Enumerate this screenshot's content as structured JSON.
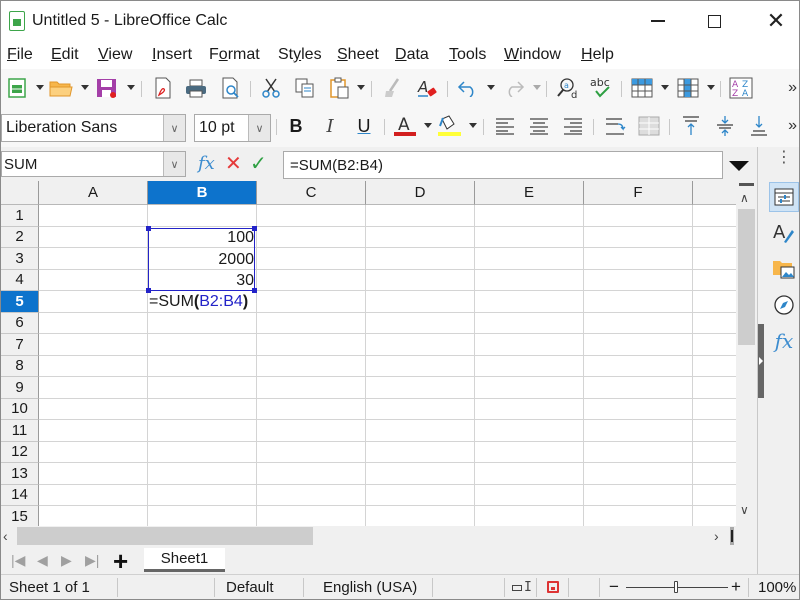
{
  "window": {
    "title": "Untitled 5 - LibreOffice Calc",
    "controls": {
      "minimize": "minimize",
      "maximize": "maximize",
      "close": "close"
    }
  },
  "menubar": {
    "items": [
      {
        "label": "File",
        "mnemonic": "F",
        "rest": "ile"
      },
      {
        "label": "Edit",
        "mnemonic": "E",
        "rest": "dit"
      },
      {
        "label": "View",
        "mnemonic": "V",
        "rest": "iew"
      },
      {
        "label": "Insert",
        "mnemonic": "I",
        "rest": "nsert"
      },
      {
        "label": "Format",
        "pre": "F",
        "mnemonic": "o",
        "rest": "rmat"
      },
      {
        "label": "Styles",
        "pre": "St",
        "mnemonic": "y",
        "rest": "les"
      },
      {
        "label": "Sheet",
        "mnemonic": "S",
        "rest": "heet"
      },
      {
        "label": "Data",
        "mnemonic": "D",
        "rest": "ata"
      },
      {
        "label": "Tools",
        "mnemonic": "T",
        "rest": "ools"
      },
      {
        "label": "Window",
        "mnemonic": "W",
        "rest": "indow"
      },
      {
        "label": "Help",
        "mnemonic": "H",
        "rest": "elp"
      }
    ]
  },
  "standard_toolbar": {
    "icons": [
      "new-spreadsheet-icon",
      "open-icon",
      "save-icon",
      "export-pdf-icon",
      "print-icon",
      "print-preview-icon",
      "cut-icon",
      "copy-icon",
      "paste-icon",
      "clone-formatting-icon",
      "clear-formatting-icon",
      "undo-icon",
      "redo-icon",
      "find-replace-icon",
      "spelling-icon",
      "row-icon",
      "column-icon",
      "sort-icon"
    ]
  },
  "formatting_toolbar": {
    "font_name": "Liberation Sans",
    "font_size": "10 pt",
    "bold": "B",
    "italic": "I",
    "underline": "U",
    "font_color_glyph": "A",
    "font_color": "#d21f1f",
    "highlight_color": "#ffff38"
  },
  "formula_bar": {
    "name_box": "SUM",
    "function_wizard": "fx",
    "cancel": "✕",
    "accept": "✓",
    "formula": "=SUM(B2:B4)"
  },
  "sheet": {
    "columns": [
      "A",
      "B",
      "C",
      "D",
      "E",
      "F"
    ],
    "selected_column": "B",
    "rows": [
      "1",
      "2",
      "3",
      "4",
      "5",
      "6",
      "7",
      "8",
      "9",
      "10",
      "11",
      "12",
      "13",
      "14",
      "15"
    ],
    "selected_row": "5",
    "cells": {
      "B2": "100",
      "B3": "2000",
      "B4": "30"
    },
    "editing_cell": {
      "address": "B5",
      "prefix": "=SUM",
      "open_paren": "(",
      "ref": "B2:B4",
      "close_paren": ")"
    },
    "reference_color": "#2323c8",
    "selection_color": "#0d73cc"
  },
  "sheet_tabs": {
    "add_label": "+",
    "tabs": [
      "Sheet1"
    ],
    "active": "Sheet1"
  },
  "statusbar": {
    "sheet_position": "Sheet 1 of 1",
    "page_style": "Default",
    "language": "English (USA)",
    "zoom_percent": "100%",
    "zoom_minus": "−",
    "zoom_plus": "+",
    "zoom_level_fraction": 0.5
  },
  "sidebar": {
    "items": [
      "properties-icon",
      "styles-icon",
      "gallery-icon",
      "navigator-icon",
      "functions-icon"
    ],
    "functions_glyph": "fx"
  }
}
